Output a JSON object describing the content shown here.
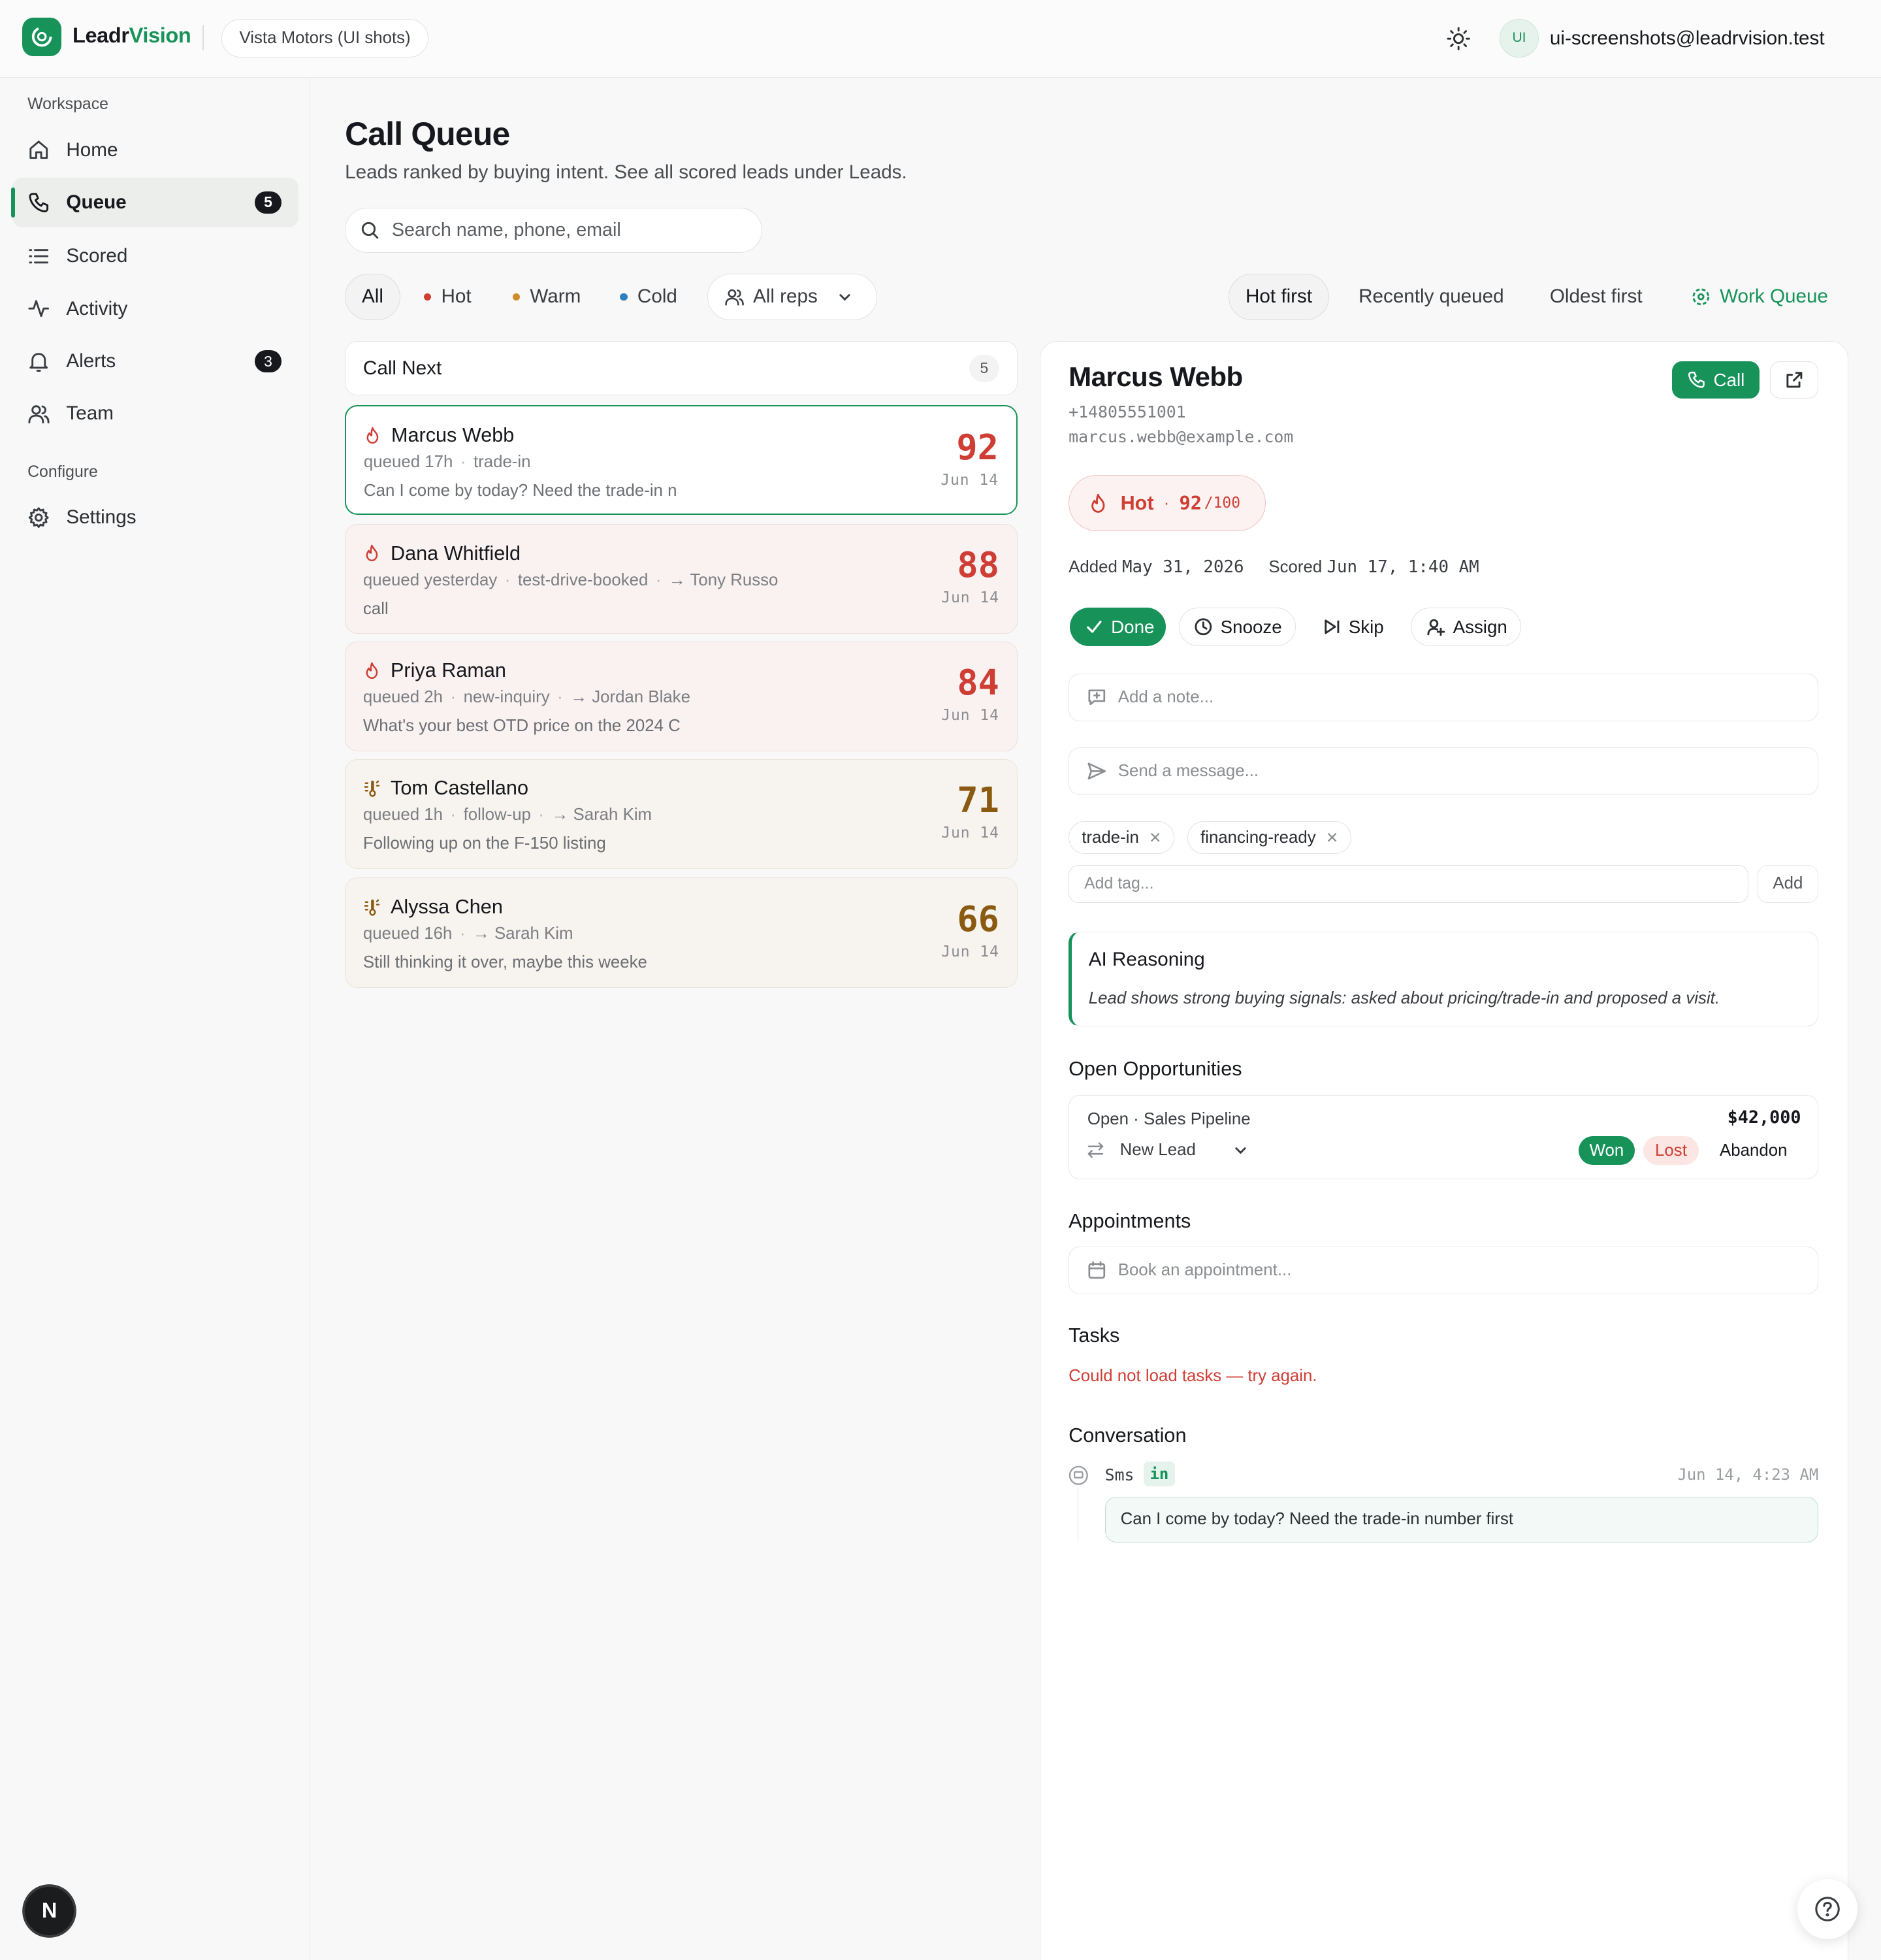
{
  "app": {
    "brand_part1": "Leadr",
    "brand_part2": "Vision",
    "workspace": "Vista Motors (UI shots)",
    "user_initials": "UI",
    "user_email": "ui-screenshots@leadrvision.test",
    "accent_color": "#17935a",
    "hot_color": "#cf3e35",
    "warm_color": "#8a5a10"
  },
  "sidebar": {
    "section_workspace": "Workspace",
    "section_configure": "Configure",
    "items": [
      {
        "label": "Home",
        "icon": "home-icon"
      },
      {
        "label": "Queue",
        "icon": "phone-icon",
        "badge": "5",
        "active": true
      },
      {
        "label": "Scored",
        "icon": "list-icon"
      },
      {
        "label": "Activity",
        "icon": "activity-icon"
      },
      {
        "label": "Alerts",
        "icon": "bell-icon",
        "badge": "3"
      },
      {
        "label": "Team",
        "icon": "users-icon"
      }
    ],
    "settings_label": "Settings",
    "dev_badge": "N"
  },
  "main": {
    "title": "Call Queue",
    "subtitle": "Leads ranked by buying intent. See all scored leads under Leads.",
    "search_placeholder": "Search name, phone, email",
    "filters": {
      "all": "All",
      "hot": "Hot",
      "warm": "Warm",
      "cold": "Cold",
      "reps": "All reps"
    },
    "sorts": {
      "hot_first": "Hot first",
      "recent": "Recently queued",
      "oldest": "Oldest first",
      "work_queue": "Work Queue"
    },
    "call_next_label": "Call Next",
    "call_next_count": "5"
  },
  "leads": [
    {
      "name": "Marcus Webb",
      "queued": "queued 17h",
      "tag": "trade-in",
      "rep": "",
      "preview": "Can I come by today? Need the trade-in n",
      "score": "92",
      "date": "Jun 14",
      "temp": "hot"
    },
    {
      "name": "Dana Whitfield",
      "queued": "queued yesterday",
      "tag": "test-drive-booked",
      "rep": "→ Tony Russo",
      "preview": "call",
      "score": "88",
      "date": "Jun 14",
      "temp": "hot"
    },
    {
      "name": "Priya Raman",
      "queued": "queued 2h",
      "tag": "new-inquiry",
      "rep": "→ Jordan Blake",
      "preview": "What's your best OTD price on the 2024 C",
      "score": "84",
      "date": "Jun 14",
      "temp": "hot"
    },
    {
      "name": "Tom Castellano",
      "queued": "queued 1h",
      "tag": "follow-up",
      "rep": "→ Sarah Kim",
      "preview": "Following up on the F-150 listing",
      "score": "71",
      "date": "Jun 14",
      "temp": "warm"
    },
    {
      "name": "Alyssa Chen",
      "queued": "queued 16h",
      "tag": "",
      "rep": "→ Sarah Kim",
      "preview": "Still thinking it over, maybe this weeke",
      "score": "66",
      "date": "Jun 14",
      "temp": "warm"
    }
  ],
  "detail": {
    "name": "Marcus Webb",
    "phone": "+14805551001",
    "email": "marcus.webb@example.com",
    "call_label": "Call",
    "temp_label": "Hot",
    "score": "92",
    "score_max": "/100",
    "added_label": "Added",
    "added_date": "May 31, 2026",
    "scored_label": "Scored",
    "scored_date": "Jun 17, 1:40 AM",
    "actions": {
      "done": "Done",
      "snooze": "Snooze",
      "skip": "Skip",
      "assign": "Assign"
    },
    "note_placeholder": "Add a note...",
    "message_placeholder": "Send a message...",
    "tags": [
      "trade-in",
      "financing-ready"
    ],
    "tag_placeholder": "Add tag...",
    "tag_add": "Add",
    "ai_title": "AI Reasoning",
    "ai_text": "Lead shows strong buying signals: asked about pricing/trade-in and proposed a visit.",
    "opps_title": "Open Opportunities",
    "opp": {
      "status": "Open · Sales Pipeline",
      "amount": "$42,000",
      "stage": "New Lead",
      "won": "Won",
      "lost": "Lost",
      "abandon": "Abandon"
    },
    "appointments_title": "Appointments",
    "appointment_placeholder": "Book an appointment...",
    "tasks_title": "Tasks",
    "tasks_error": "Could not load tasks — try again.",
    "conversation_title": "Conversation",
    "message": {
      "channel": "Sms",
      "direction": "in",
      "timestamp": "Jun 14, 4:23 AM",
      "text": "Can I come by today? Need the trade-in number first"
    }
  }
}
